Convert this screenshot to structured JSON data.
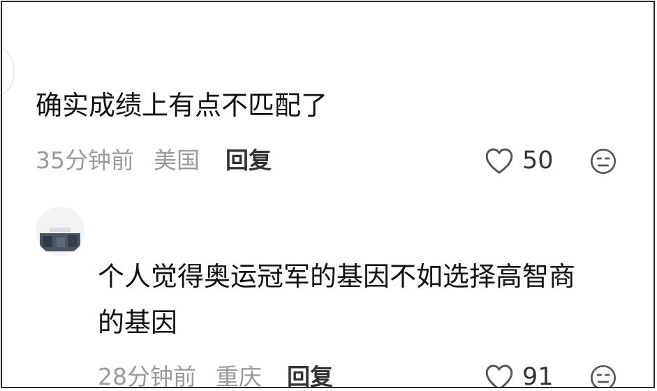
{
  "comments": [
    {
      "text": "确实成绩上有点不匹配了",
      "time": "35分钟前",
      "location": "美国",
      "reply_label": "回复",
      "likes": "50",
      "like_icon": "heart-outline-icon",
      "emoji_icon": "neutral-face-icon"
    },
    {
      "text_line1": "个人觉得奥运冠军的基因不如选择高智商",
      "text_line2": "的基因",
      "time": "28分钟前",
      "location": "重庆",
      "reply_label": "回复",
      "likes": "91",
      "like_icon": "heart-outline-icon",
      "emoji_icon": "neutral-face-icon"
    }
  ],
  "colors": {
    "text": "#111111",
    "meta": "#9a9a9a",
    "action": "#333333",
    "border": "#2a2a2a"
  }
}
